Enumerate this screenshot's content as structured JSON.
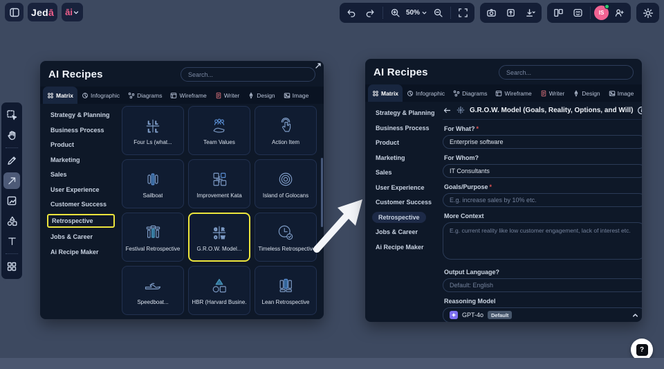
{
  "topbar": {
    "logo_prefix": "Jed",
    "logo_accent": "ā",
    "ai_menu_label": "āi",
    "zoom_level": "50%",
    "avatar_initials": "IS"
  },
  "tabs": [
    "Matrix",
    "Infographic",
    "Diagrams",
    "Wireframe",
    "Writer",
    "Design",
    "Image"
  ],
  "categories": [
    "Strategy & Planning",
    "Business Process",
    "Product",
    "Marketing",
    "Sales",
    "User Experience",
    "Customer Success",
    "Retrospective",
    "Jobs & Career",
    "Ai Recipe Maker"
  ],
  "recipes_panel": {
    "title": "AI Recipes",
    "search_placeholder": "Search...",
    "cards": [
      "Four Ls (what...",
      "Team Values",
      "Action Item",
      "Sailboat",
      "Improvement Kata",
      "Island of Golocans",
      "Festival Retrospective",
      "G.R.O.W. Model...",
      "Timeless Retrospective",
      "Speedboat...",
      "HBR (Harvard Busine...",
      "Lean Retrospective"
    ]
  },
  "form_panel": {
    "title": "AI Recipes",
    "search_placeholder": "Search...",
    "form": {
      "title": "G.R.O.W. Model (Goals, Reality, Options, and Will)",
      "required_mark": "*",
      "for_what_label": "For What?",
      "for_what_value": "Enterprise software",
      "for_whom_label": "For Whom?",
      "for_whom_value": "IT Consultants",
      "goals_label": "Goals/Purpose",
      "goals_placeholder": "E.g. increase sales by 10% etc.",
      "context_label": "More Context",
      "context_placeholder": "E.g. current reality like low customer engagement, lack of interest etc.",
      "language_label": "Output Language?",
      "language_placeholder": "Default: English",
      "model_label": "Reasoning Model",
      "model_name": "GPT-4o",
      "model_badge": "Default"
    }
  },
  "help_button_label": "?",
  "colors": {
    "accent_pink": "#ee5f8b",
    "highlight_yellow": "#ece43c",
    "model_purple": "#7d6ef0",
    "avatar_pink": "#f06292",
    "online_green": "#2ecc71"
  }
}
